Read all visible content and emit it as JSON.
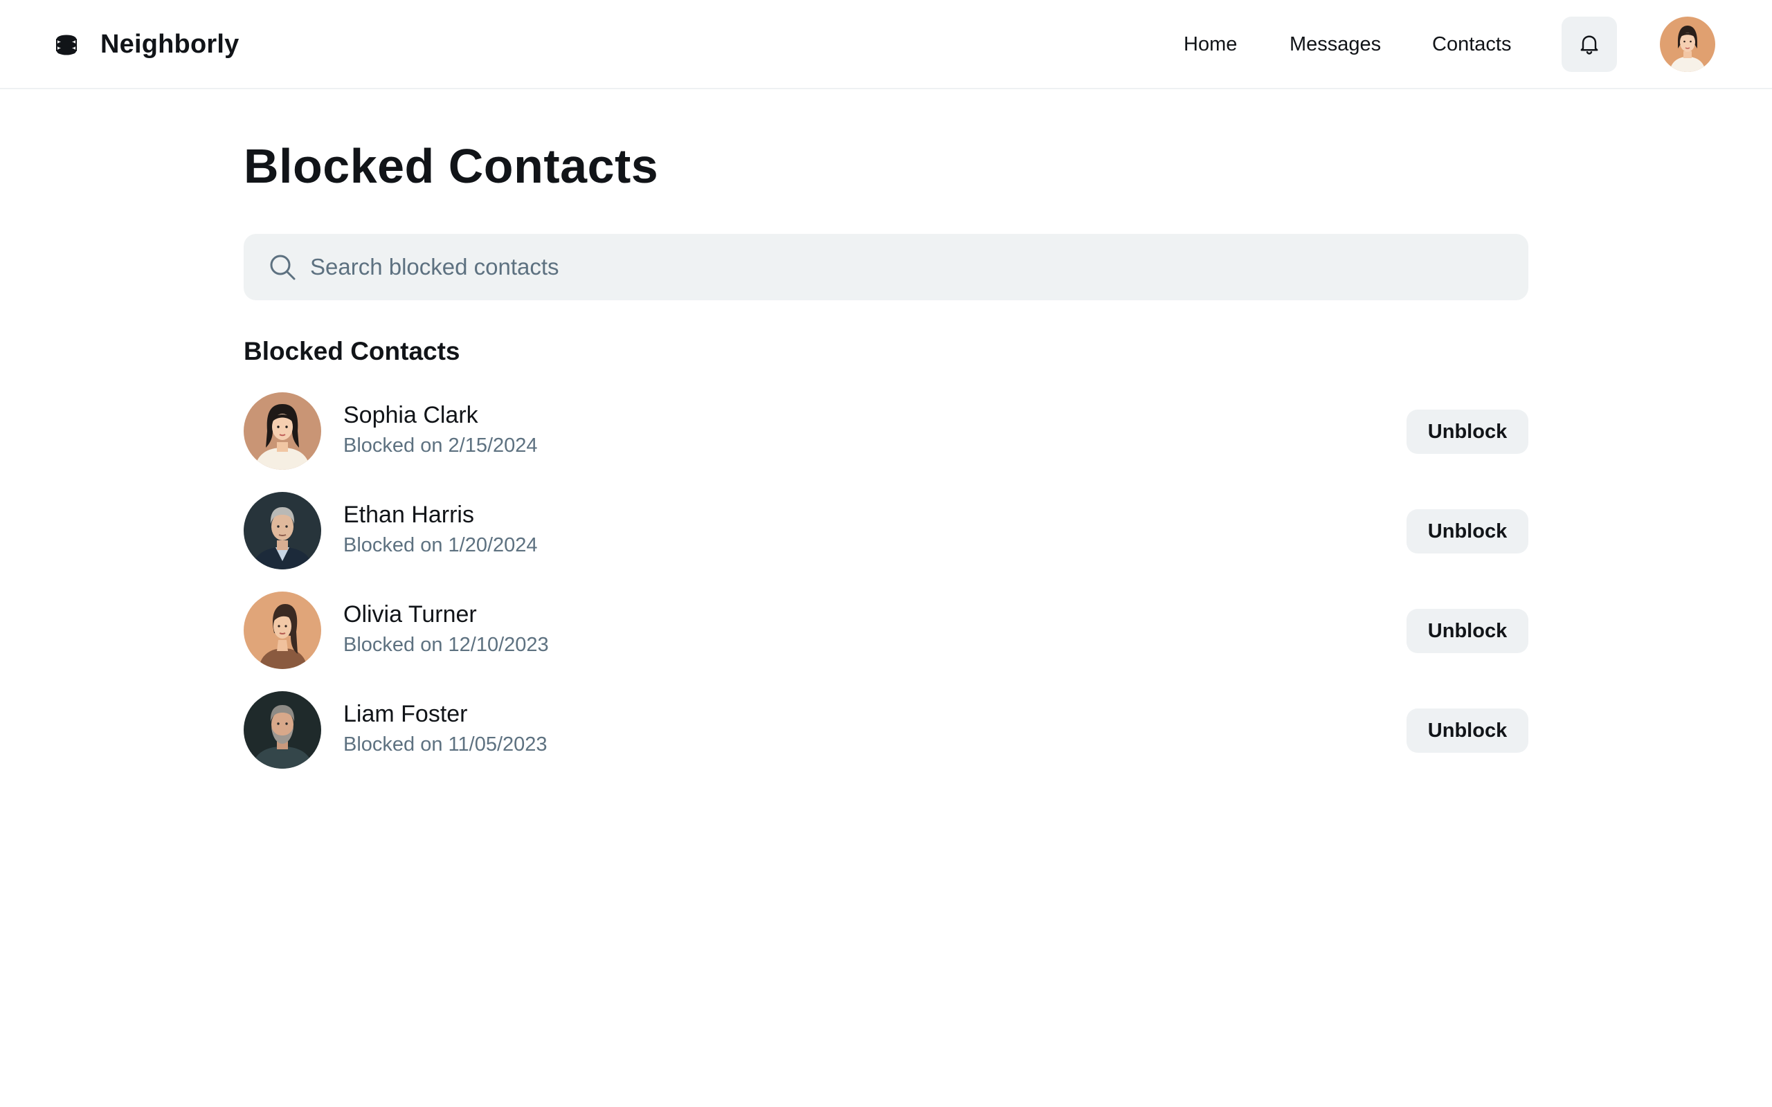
{
  "app": {
    "name": "Neighborly",
    "logo_icon": "stacked-layers-icon"
  },
  "nav": {
    "links": [
      {
        "label": "Home"
      },
      {
        "label": "Messages"
      },
      {
        "label": "Contacts"
      }
    ],
    "notifications_icon": "bell-icon",
    "user_avatar": "user-avatar"
  },
  "page": {
    "title": "Blocked Contacts",
    "search": {
      "placeholder": "Search blocked contacts",
      "value": "",
      "icon": "search-icon"
    },
    "section_title": "Blocked Contacts",
    "contacts": [
      {
        "name": "Sophia Clark",
        "blocked_on": "Blocked on 2/15/2024",
        "action": "Unblock"
      },
      {
        "name": "Ethan Harris",
        "blocked_on": "Blocked on 1/20/2024",
        "action": "Unblock"
      },
      {
        "name": "Olivia Turner",
        "blocked_on": "Blocked on 12/10/2023",
        "action": "Unblock"
      },
      {
        "name": "Liam Foster",
        "blocked_on": "Blocked on 11/05/2023",
        "action": "Unblock"
      }
    ]
  },
  "colors": {
    "text_primary": "#111418",
    "text_secondary": "#5d7180",
    "surface_muted": "#eef1f3",
    "divider": "#eef1f3"
  }
}
